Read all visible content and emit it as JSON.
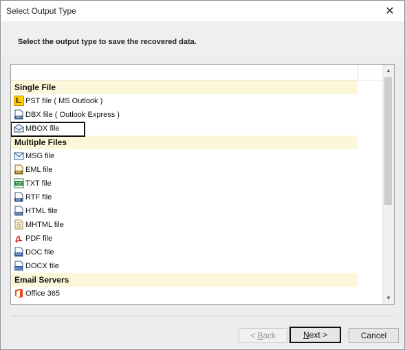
{
  "window": {
    "title": "Select Output Type",
    "close_glyph": "✕"
  },
  "instruction": "Select the output type to save the recovered data.",
  "list": {
    "groups": [
      {
        "label": "Single File",
        "items": [
          {
            "label": "PST file ( MS Outlook )",
            "icon": "pst-icon"
          },
          {
            "label": "DBX file ( Outlook Express )",
            "icon": "dbx-icon"
          },
          {
            "label": "MBOX file",
            "icon": "mbox-icon",
            "selected": true
          }
        ]
      },
      {
        "label": "Multiple Files",
        "items": [
          {
            "label": "MSG file",
            "icon": "msg-icon"
          },
          {
            "label": "EML file",
            "icon": "eml-icon"
          },
          {
            "label": "TXT file",
            "icon": "txt-icon"
          },
          {
            "label": "RTF file",
            "icon": "rtf-icon"
          },
          {
            "label": "HTML file",
            "icon": "html-icon"
          },
          {
            "label": "MHTML file",
            "icon": "mhtml-icon"
          },
          {
            "label": "PDF file",
            "icon": "pdf-icon"
          },
          {
            "label": "DOC file",
            "icon": "doc-icon"
          },
          {
            "label": "DOCX file",
            "icon": "docx-icon"
          }
        ]
      },
      {
        "label": "Email Servers",
        "items": [
          {
            "label": "Office 365",
            "icon": "office365-icon"
          }
        ]
      }
    ]
  },
  "buttons": {
    "back": {
      "prefix": "< ",
      "accel": "B",
      "rest": "ack"
    },
    "next": {
      "accel": "N",
      "rest": "ext >"
    },
    "cancel": "Cancel"
  },
  "colors": {
    "group_band": "#fdf7d9",
    "background": "#ececec"
  }
}
